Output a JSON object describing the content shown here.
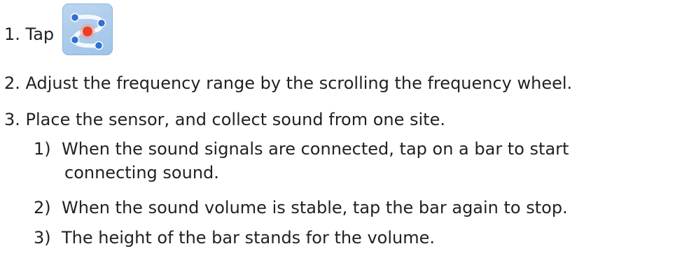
{
  "step1": {
    "text": "1. Tap",
    "icon": "frequency-map-icon"
  },
  "step2": {
    "text": "2. Adjust the frequency range by the scrolling the frequency wheel."
  },
  "step3": {
    "text": "3. Place the sensor, and collect sound from one site.",
    "substeps": [
      {
        "num": "1)",
        "text": "When the sound signals are connected, tap on a bar to start",
        "cont": "connecting sound."
      },
      {
        "num": "2)",
        "text": "When the sound volume is stable, tap the bar again to stop."
      },
      {
        "num": "3)",
        "text": "The height of the bar stands for the volume."
      }
    ]
  },
  "colors": {
    "icon_bg": "#a9cbec",
    "dot": "#2f6fd8",
    "center_dot": "#e8402a"
  }
}
